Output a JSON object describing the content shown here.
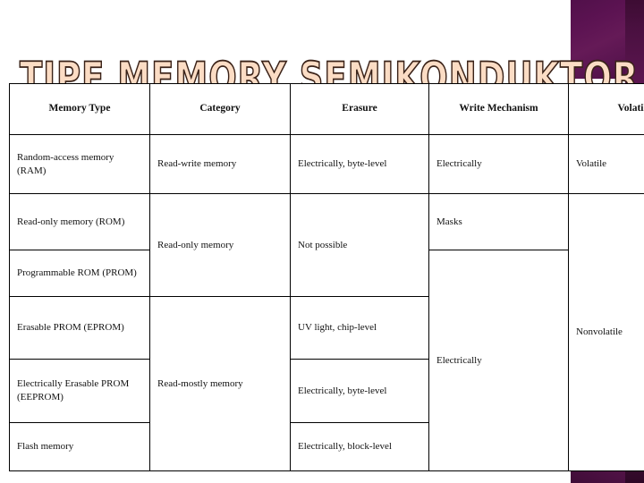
{
  "slide": {
    "title": "TIPE MEMORY SEMIKONDUKTOR",
    "background_color": "#ffffff",
    "accent_color": "#8e2a7c",
    "accent_dark_color": "#3d0c33",
    "title_fill_color": "#fbdcc4",
    "title_outline_color": "#3a2218"
  },
  "table": {
    "headers": [
      "Memory Type",
      "Category",
      "Erasure",
      "Write Mechanism",
      "Volatility"
    ],
    "rows": [
      {
        "memory_type": "Random-access memory (RAM)",
        "category": "Read-write memory",
        "erasure": "Electrically, byte-level",
        "write_mechanism": "Electrically",
        "volatility": "Volatile"
      },
      {
        "memory_type": "Read-only memory (ROM)",
        "category": "Read-only memory",
        "erasure": "Not possible",
        "write_mechanism": "Masks",
        "volatility": "Nonvolatile"
      },
      {
        "memory_type": "Programmable ROM (PROM)",
        "category": "",
        "erasure": "",
        "write_mechanism": "Electrically",
        "volatility": ""
      },
      {
        "memory_type": "Erasable PROM (EPROM)",
        "category": "Read-mostly memory",
        "erasure": "UV light, chip-level",
        "write_mechanism": "",
        "volatility": ""
      },
      {
        "memory_type": "Electrically Erasable PROM (EEPROM)",
        "category": "",
        "erasure": "Electrically, byte-level",
        "write_mechanism": "",
        "volatility": ""
      },
      {
        "memory_type": "Flash memory",
        "category": "",
        "erasure": "Electrically, block-level",
        "write_mechanism": "",
        "volatility": ""
      }
    ]
  }
}
